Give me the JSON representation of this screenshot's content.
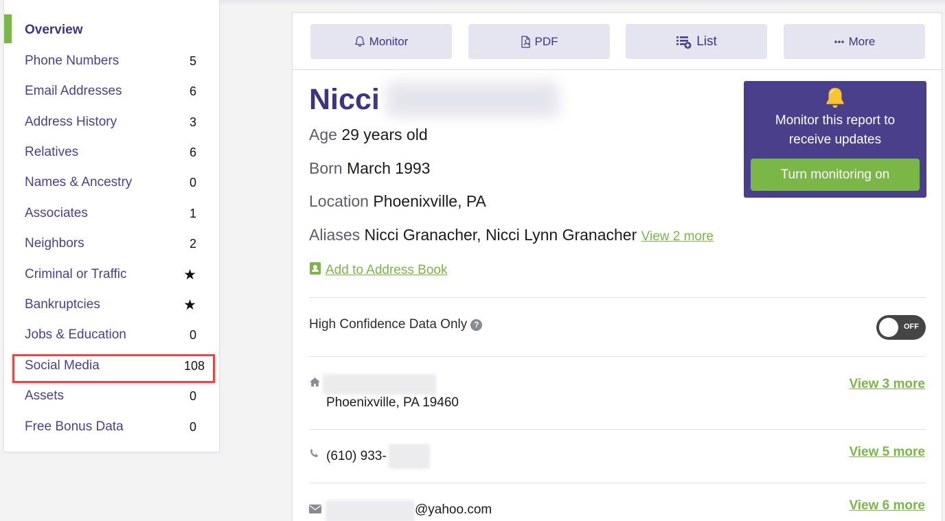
{
  "sidebar": {
    "items": [
      {
        "label": "Overview",
        "count": ""
      },
      {
        "label": "Phone Numbers",
        "count": "5"
      },
      {
        "label": "Email Addresses",
        "count": "6"
      },
      {
        "label": "Address History",
        "count": "3"
      },
      {
        "label": "Relatives",
        "count": "6"
      },
      {
        "label": "Names & Ancestry",
        "count": "0"
      },
      {
        "label": "Associates",
        "count": "1"
      },
      {
        "label": "Neighbors",
        "count": "2"
      },
      {
        "label": "Criminal or Traffic",
        "count": "★"
      },
      {
        "label": "Bankruptcies",
        "count": "★"
      },
      {
        "label": "Jobs & Education",
        "count": "0"
      },
      {
        "label": "Social Media",
        "count": "108"
      },
      {
        "label": "Assets",
        "count": "0"
      },
      {
        "label": "Free Bonus Data",
        "count": "0"
      }
    ]
  },
  "toolbar": {
    "monitor_label": "Monitor",
    "pdf_label": "PDF",
    "list_label": "List",
    "more_label": "More"
  },
  "profile": {
    "first_name": "Nicci",
    "age_label": "Age",
    "age_value": "29 years old",
    "born_label": "Born",
    "born_value": "March 1993",
    "location_label": "Location",
    "location_value": "Phoenixville, PA",
    "aliases_label": "Aliases",
    "aliases_value": "Nicci Granacher, Nicci Lynn Granacher",
    "aliases_more": "View 2 more",
    "add_address_book": "Add to Address Book"
  },
  "monitor_card": {
    "text_line1": "Monitor this report to",
    "text_line2": "receive updates",
    "button_label": "Turn monitoring on"
  },
  "confidence": {
    "label": "High Confidence Data Only",
    "help": "?",
    "toggle_state": "OFF"
  },
  "contacts": {
    "address_city": "Phoenixville, PA 19460",
    "address_more": "View 3 more",
    "phone_partial": "(610) 933-",
    "phone_more": "View 5 more",
    "email_partial": "@yahoo.com",
    "email_more": "View 6 more"
  },
  "colors": {
    "brand_purple": "#4a3f8a",
    "accent_green": "#7ab648",
    "highlight_red": "#e04a4a"
  }
}
